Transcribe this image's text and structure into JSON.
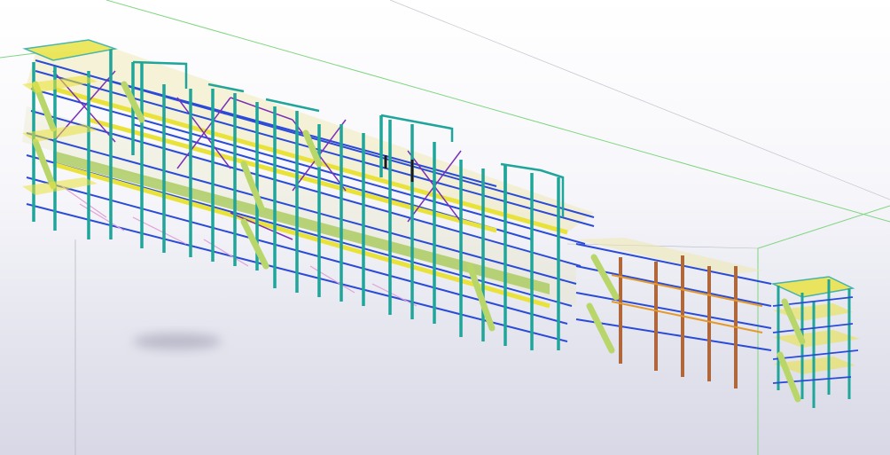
{
  "viewport": {
    "name": "3D model view",
    "background_top": "#ffffff",
    "background_bottom": "#d8d8e6"
  },
  "colors": {
    "grid_green": "#7fd67f",
    "grid_grey": "#b8b8c4",
    "column_teal": "#1fa59a",
    "beam_blue": "#2a4bd8",
    "brace_purple": "#7a2fb8",
    "deck_yellow": "#e9e23a",
    "stair_green": "#b9d66a",
    "column_brown": "#b0683a",
    "pink_member": "#e2a2d8",
    "orange_member": "#e39a2c",
    "black_accent": "#1a1a1a"
  }
}
